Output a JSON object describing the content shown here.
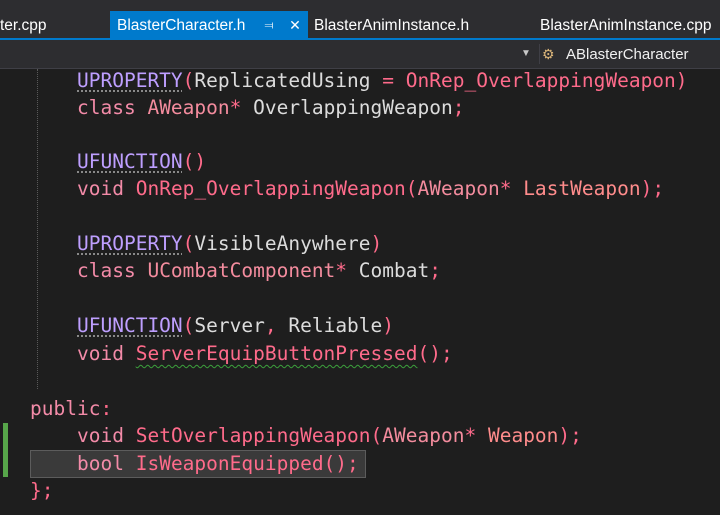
{
  "tabs": [
    {
      "label": "ter.cpp",
      "active": false
    },
    {
      "label": "BlasterCharacter.h",
      "active": true
    },
    {
      "label": "BlasterAnimInstance.h",
      "active": false
    },
    {
      "label": "BlasterAnimInstance.cpp",
      "active": false
    }
  ],
  "tab_icons": {
    "pin": "pin-icon",
    "close": "close-icon"
  },
  "navbar": {
    "member_scope": "ABlasterCharacter",
    "member_icon": "class-member-icon",
    "dropdown_icon": "chevron-down-icon"
  },
  "colors": {
    "accent": "#007acc",
    "editor_bg": "#1e1e1e",
    "change_marker": "#57a64a"
  },
  "code": {
    "line1": {
      "macro": "UPROPERTY",
      "open": "(",
      "a": "ReplicatedUsing",
      "eq": " = ",
      "b": "OnRep_OverlappingWeapon",
      "close": ")"
    },
    "line2": {
      "kw": "class",
      "type": "AWeapon",
      "star": "*",
      "name": "OverlappingWeapon",
      "semi": ";"
    },
    "line4": {
      "macro": "UFUNCTION",
      "parens": "()"
    },
    "line5": {
      "kw": "void",
      "fn": "OnRep_OverlappingWeapon",
      "open": "(",
      "type": "AWeapon",
      "star": "*",
      "param": "LastWeapon",
      "close": ");"
    },
    "line7": {
      "macro": "UPROPERTY",
      "open": "(",
      "a": "VisibleAnywhere",
      "close": ")"
    },
    "line8": {
      "kw": "class",
      "type": "UCombatComponent",
      "star": "*",
      "name": "Combat",
      "semi": ";"
    },
    "line10": {
      "macro": "UFUNCTION",
      "open": "(",
      "a": "Server",
      "comma": ", ",
      "b": "Reliable",
      "close": ")"
    },
    "line11": {
      "kw": "void",
      "fn": "ServerEquipButtonPressed",
      "parens": "();"
    },
    "line13": {
      "kw": "public",
      "colon": ":"
    },
    "line14": {
      "kw": "void",
      "fn": "SetOverlappingWeapon",
      "open": "(",
      "type": "AWeapon",
      "star": "*",
      "param": "Weapon",
      "close": ");"
    },
    "line15": {
      "kw": "bool",
      "fn": "IsWeaponEquipped",
      "parens": "();"
    },
    "line16": {
      "brace": "};"
    }
  }
}
